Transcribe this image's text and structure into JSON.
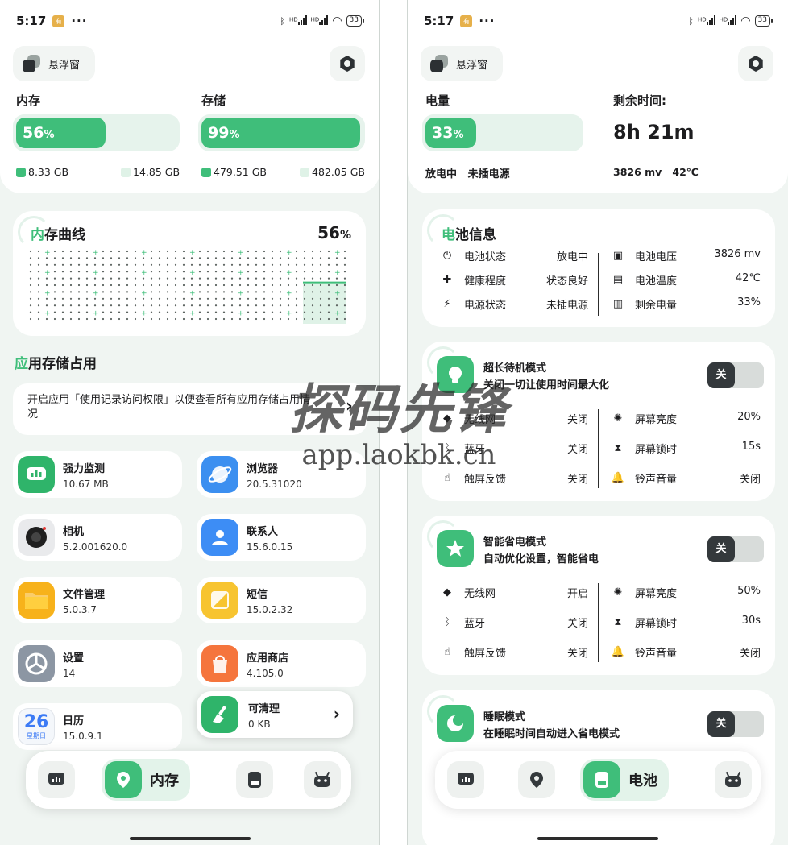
{
  "status": {
    "time": "5:17",
    "app_badge": "有品",
    "dots": "···",
    "hd1": "HD",
    "hd2": "HD",
    "battery": "33"
  },
  "left": {
    "floating": "悬浮窗",
    "memory": {
      "label": "内存",
      "percent": "56",
      "unit": "%",
      "fill": 0.56,
      "used": "8.33 GB",
      "total": "14.85 GB"
    },
    "storage": {
      "label": "存储",
      "percent": "99",
      "unit": "%",
      "fill": 0.99,
      "used": "479.51 GB",
      "total": "482.05 GB"
    },
    "curve": {
      "title_first": "内",
      "title_rest": "存曲线",
      "percent": "56",
      "unit": "%",
      "fill_level": 0.56
    },
    "section": {
      "title_first": "应",
      "title_rest": "用存储占用"
    },
    "permission": {
      "text": "开启应用「使用记录访问权限」以便查看所有应用存储占用情况",
      "arrow": "›"
    },
    "apps": [
      {
        "name": "强力监测",
        "sub": "10.67 MB",
        "icon": "monitor-icon",
        "color": "#2fb46a"
      },
      {
        "name": "浏览器",
        "sub": "20.5.31020",
        "icon": "browser-icon",
        "color": "#3b8ff0"
      },
      {
        "name": "相机",
        "sub": "5.2.001620.0",
        "icon": "camera-icon",
        "color": "#e9eaec"
      },
      {
        "name": "联系人",
        "sub": "15.6.0.15",
        "icon": "contacts-icon",
        "color": "#3d8df5"
      },
      {
        "name": "文件管理",
        "sub": "5.0.3.7",
        "icon": "folder-icon",
        "color": "#f7b21b"
      },
      {
        "name": "短信",
        "sub": "15.0.2.32",
        "icon": "message-icon",
        "color": "#f7c430"
      },
      {
        "name": "设置",
        "sub": "14",
        "icon": "settings-icon",
        "color": "#8c96a3"
      },
      {
        "name": "应用商店",
        "sub": "4.105.0",
        "icon": "store-icon",
        "color": "#f5753d"
      },
      {
        "name": "日历",
        "sub": "15.0.9.1",
        "icon": "calendar-icon",
        "color": "#f4f7fb",
        "day": "26",
        "weekday": "星期日"
      }
    ],
    "clean": {
      "title": "可清理",
      "value": "0 KB",
      "chevron": "›"
    },
    "nav": {
      "active_label": "内存"
    }
  },
  "right": {
    "floating": "悬浮窗",
    "battery": {
      "label": "电量",
      "percent": "33",
      "unit": "%",
      "fill": 0.33
    },
    "remaining": {
      "label": "剩余时间:",
      "value": "8h 21m"
    },
    "charge_state": "放电中",
    "power_source": "未插电源",
    "voltage_small": "3826 mv",
    "temp_small": "42℃",
    "info": {
      "title_first": "电",
      "title_rest": "池信息",
      "left_rows": [
        {
          "label": "电池状态",
          "value": "放电中",
          "icon": "power-icon",
          "glyph": "⏻"
        },
        {
          "label": "健康程度",
          "value": "状态良好",
          "icon": "health-icon",
          "glyph": "✚"
        },
        {
          "label": "电源状态",
          "value": "未插电源",
          "icon": "plug-icon",
          "glyph": "⚡"
        }
      ],
      "right_rows": [
        {
          "label": "电池电压",
          "value": "3826 mv",
          "icon": "voltage-icon",
          "glyph": "▣"
        },
        {
          "label": "电池温度",
          "value": "42℃",
          "icon": "thermometer-icon",
          "glyph": "▤"
        },
        {
          "label": "剩余电量",
          "value": "33%",
          "icon": "battery-level-icon",
          "glyph": "▥"
        }
      ]
    },
    "modes": [
      {
        "title": "超长待机模式",
        "sub": "关闭一切让使用时间最大化",
        "toggle": "关",
        "icon": "lightbulb-icon",
        "left_rows": [
          {
            "label": "无线网",
            "value": "关闭",
            "glyph": "◆"
          },
          {
            "label": "蓝牙",
            "value": "关闭",
            "glyph": "ᛒ"
          },
          {
            "label": "触屏反馈",
            "value": "关闭",
            "glyph": "☝"
          }
        ],
        "right_rows": [
          {
            "label": "屏幕亮度",
            "value": "20%",
            "glyph": "✺"
          },
          {
            "label": "屏幕锁时",
            "value": "15s",
            "glyph": "⧗"
          },
          {
            "label": "铃声音量",
            "value": "关闭",
            "glyph": "🔔"
          }
        ]
      },
      {
        "title": "智能省电模式",
        "sub": "自动优化设置，智能省电",
        "toggle": "关",
        "icon": "star-icon",
        "left_rows": [
          {
            "label": "无线网",
            "value": "开启",
            "glyph": "◆"
          },
          {
            "label": "蓝牙",
            "value": "关闭",
            "glyph": "ᛒ"
          },
          {
            "label": "触屏反馈",
            "value": "关闭",
            "glyph": "☝"
          }
        ],
        "right_rows": [
          {
            "label": "屏幕亮度",
            "value": "50%",
            "glyph": "✺"
          },
          {
            "label": "屏幕锁时",
            "value": "30s",
            "glyph": "⧗"
          },
          {
            "label": "铃声音量",
            "value": "关闭",
            "glyph": "🔔"
          }
        ]
      },
      {
        "title": "睡眠模式",
        "sub": "在睡眠时间自动进入省电模式",
        "toggle": "关",
        "icon": "moon-icon"
      }
    ],
    "nav": {
      "active_label": "电池"
    }
  },
  "watermark": {
    "big": "探码先锋",
    "url": "app.laokbk.cn"
  }
}
